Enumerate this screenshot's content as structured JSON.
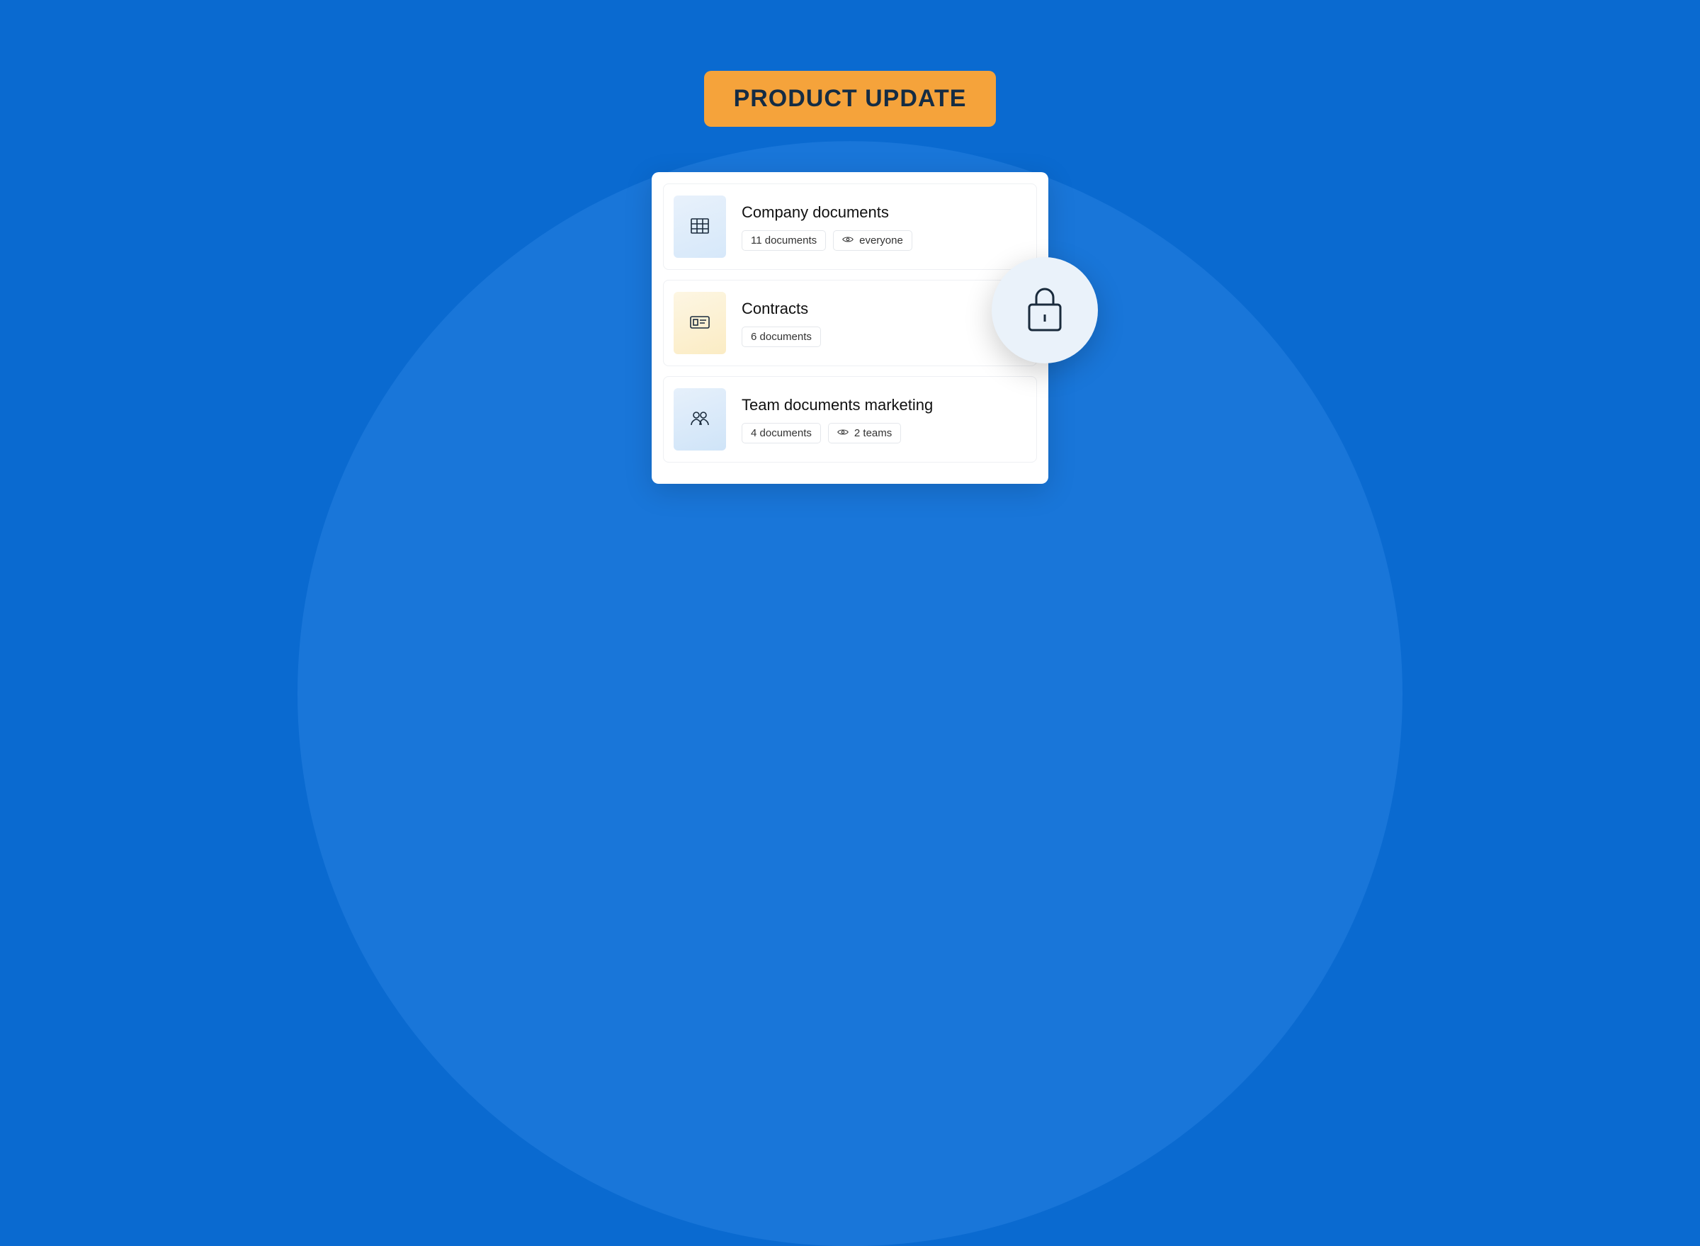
{
  "badge": {
    "label": "PRODUCT UPDATE"
  },
  "folders": [
    {
      "title": "Company documents",
      "doc_count": "11 documents",
      "visibility": "everyone",
      "thumb": "building"
    },
    {
      "title": "Contracts",
      "doc_count": "6 documents",
      "visibility": null,
      "thumb": "id-card"
    },
    {
      "title": "Team documents marketing",
      "doc_count": "4 documents",
      "visibility": "2 teams",
      "thumb": "people"
    }
  ]
}
